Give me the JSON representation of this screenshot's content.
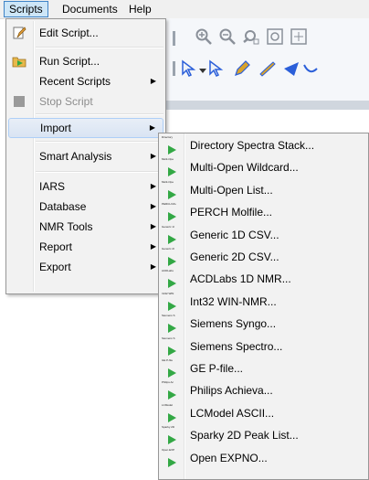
{
  "menubar": {
    "items": [
      {
        "label": "Scripts"
      },
      {
        "label": "Documents"
      },
      {
        "label": "Help"
      }
    ]
  },
  "scripts_menu": {
    "items": [
      {
        "label": "Edit Script...",
        "icon": "edit-script-icon"
      },
      {
        "label": "Run Script...",
        "icon": "run-script-icon"
      },
      {
        "label": "Recent Scripts",
        "has_submenu": true
      },
      {
        "label": "Stop Script",
        "icon": "stop-script-icon",
        "disabled": true
      },
      {
        "label": "Import",
        "has_submenu": true,
        "highlighted": true
      },
      {
        "label": "Smart Analysis",
        "has_submenu": true
      },
      {
        "label": "IARS",
        "has_submenu": true
      },
      {
        "label": "Database",
        "has_submenu": true
      },
      {
        "label": "NMR Tools",
        "has_submenu": true
      },
      {
        "label": "Report",
        "has_submenu": true
      },
      {
        "label": "Export",
        "has_submenu": true
      }
    ],
    "arrow_glyph": "▶"
  },
  "import_submenu": {
    "items": [
      {
        "label": "Directory Spectra Stack...",
        "icon_caption": "Directory"
      },
      {
        "label": "Multi-Open Wildcard...",
        "icon_caption": "Multi-Ope"
      },
      {
        "label": "Multi-Open List...",
        "icon_caption": "Multi-Ope"
      },
      {
        "label": "PERCH Molfile...",
        "icon_caption": "PERCH Mo"
      },
      {
        "label": "Generic 1D CSV...",
        "icon_caption": "Generic 1I"
      },
      {
        "label": "Generic 2D CSV...",
        "icon_caption": "Generic 2I"
      },
      {
        "label": "ACDLabs 1D NMR...",
        "icon_caption": "ACDLabs"
      },
      {
        "label": "Int32 WIN-NMR...",
        "icon_caption": "Int32 WIN"
      },
      {
        "label": "Siemens Syngo...",
        "icon_caption": "Siemens S"
      },
      {
        "label": "Siemens Spectro...",
        "icon_caption": "Siemens S"
      },
      {
        "label": "GE P-file...",
        "icon_caption": "GE P-file"
      },
      {
        "label": "Philips Achieva...",
        "icon_caption": "Philips Ac"
      },
      {
        "label": "LCModel ASCII...",
        "icon_caption": "LCModel"
      },
      {
        "label": "Sparky 2D Peak List...",
        "icon_caption": "Sparky 2D"
      },
      {
        "label": "Open EXPNO...",
        "icon_caption": "Open EXP"
      }
    ],
    "icon_color": "#33a845"
  },
  "colors": {
    "menu_bg": "#f2f2f2",
    "hover_bg": "#d9e4f3",
    "hover_border": "#aecff7",
    "menubar_active_bg": "#cde6f7",
    "menubar_active_border": "#3f83c6",
    "disabled_text": "#8d8d8d",
    "toolbar_blue": "#2b5fd9",
    "toolbar_gold": "#d9a32b"
  }
}
